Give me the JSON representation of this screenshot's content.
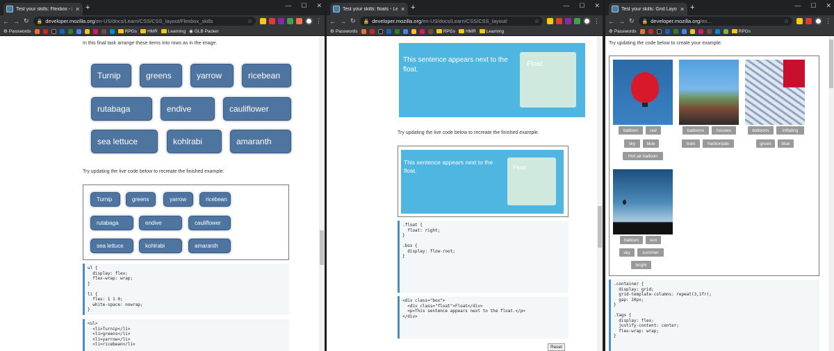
{
  "windows": [
    {
      "tab_title": "Test your skills: Flexbox - Learn w",
      "url_host": "developer.mozilla.org",
      "url_path": "/en-US/docs/Learn/CSS/CSS_layout/Flexbox_skills",
      "bookmarks": [
        "Passwords",
        "RPGs",
        "HMR",
        "Learning",
        "GLB Packer"
      ],
      "intro": "In this final task arrange these items into rows as in the image.",
      "try_text": "Try updating the live code below to recreate the finished example:",
      "rows": [
        [
          "Turnip",
          "greens",
          "yarrow",
          "ricebean"
        ],
        [
          "rutabaga",
          "endive",
          "cauliflower"
        ],
        [
          "sea lettuce",
          "kohlrabi",
          "amaranth"
        ]
      ],
      "css_code": "ul {\n  display: flex;\n  flex-wrap: wrap;\n}\n\nli {\n  flex: 1 1 0;\n  white-space: nowrap;\n}",
      "html_code": "<ul>\n  <li>Turnip</li>\n  <li>greens</li>\n  <li>yarrow</li>\n  <li>ricebean</li>"
    },
    {
      "tab_title": "Test your skills: floats - Learn web",
      "url_host": "developer.mozilla.org",
      "url_path": "/en-US/docs/Learn/CSS/CSS_layout/",
      "bookmarks": [
        "Passwords",
        "RPGs",
        "HMR",
        "Learning"
      ],
      "sentence": "This sentence appears next to the float.",
      "float_label": "Float",
      "try_text": "Try updating the live code below to recreate the finished example.",
      "css_code": ".float {\n  float: right;\n}\n\n.box {\n  display: flow-root;\n}",
      "html_code": "<div class=\"box\">\n  <div class=\"float\">Float</div>\n  <p>This sentence appears next to the float.</p>\n</div>",
      "reset": "Reset"
    },
    {
      "tab_title": "Test your skills: Grid Layout - Le",
      "url_host": "developer.mozilla.org",
      "url_path": "/en...",
      "bookmarks": [
        "Passwords",
        "RPGs"
      ],
      "intro": "Try updating the code below to create your example.",
      "cards": [
        {
          "tags": [
            "balloon",
            "red",
            "sky",
            "blue",
            "Hot air balloon"
          ]
        },
        {
          "tags": [
            "balloons",
            "houses",
            "train",
            "harborside"
          ]
        },
        {
          "tags": [
            "balloons",
            "inflating",
            "green",
            "blue"
          ]
        },
        {
          "tags": [
            "balloon",
            "sun",
            "sky",
            "summer",
            "bright"
          ]
        }
      ],
      "css_code": ".container {\n  display: grid;\n  grid-template-columns: repeat(3,1fr);\n  gap: 20px;\n}\n\n.tags {\n  display: flex;\n  justify-content: center;\n  flex-wrap: wrap;\n}"
    }
  ]
}
